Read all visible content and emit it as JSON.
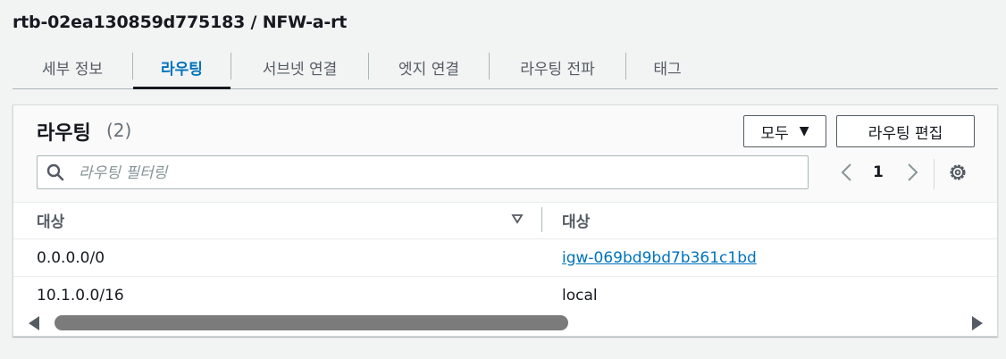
{
  "header": {
    "title": "rtb-02ea130859d775183 / NFW-a-rt"
  },
  "tabs": [
    {
      "label": "세부 정보",
      "active": false
    },
    {
      "label": "라우팅",
      "active": true
    },
    {
      "label": "서브넷 연결",
      "active": false
    },
    {
      "label": "엣지 연결",
      "active": false
    },
    {
      "label": "라우팅 전파",
      "active": false
    },
    {
      "label": "태그",
      "active": false
    }
  ],
  "panel": {
    "title": "라우팅",
    "count": "(2)",
    "filter_select": {
      "value": "모두",
      "icon": "caret-down-icon"
    },
    "edit_button": "라우팅 편집",
    "search": {
      "placeholder": "라우팅 필터링",
      "value": "",
      "icon": "search-icon"
    },
    "pagination": {
      "current_page": "1"
    },
    "settings_icon": "gear-icon"
  },
  "table": {
    "columns": [
      "대상",
      "대상"
    ],
    "rows": [
      {
        "destination": "0.0.0.0/0",
        "target": "igw-069bd9bd7b361c1bd",
        "target_is_link": true
      },
      {
        "destination": "10.1.0.0/16",
        "target": "local",
        "target_is_link": false
      }
    ]
  },
  "colors": {
    "accent": "#0073bb",
    "text": "#16191f",
    "muted": "#545b64",
    "background": "#f2f3f3"
  }
}
